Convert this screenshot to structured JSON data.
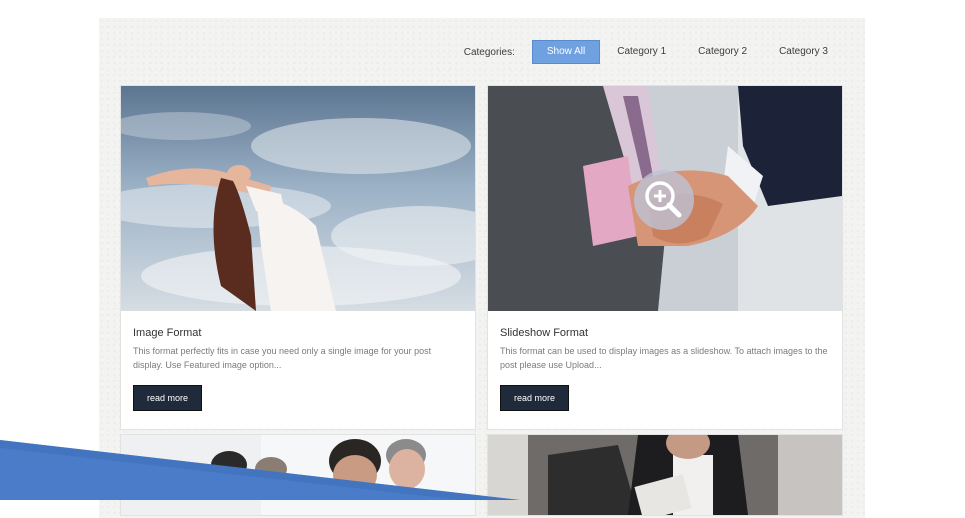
{
  "filters": {
    "label": "Categories:",
    "options": [
      "Show All",
      "Category 1",
      "Category 2",
      "Category 3"
    ],
    "active": "Show All",
    "accent_color": "#6fa0df"
  },
  "cards": [
    {
      "title": "Image Format",
      "excerpt": "This format perfectly fits in case you need only a single image for your post display. Use Featured image option...",
      "button": "read more"
    },
    {
      "title": "Slideshow Format",
      "excerpt": "This format can be used to display images as a slideshow. To attach images to the post please use Upload...",
      "button": "read more",
      "overlay_icon": "zoom-in-icon"
    }
  ],
  "colors": {
    "button_bg": "#1f2b3a",
    "banner": "#4a7cc9"
  }
}
